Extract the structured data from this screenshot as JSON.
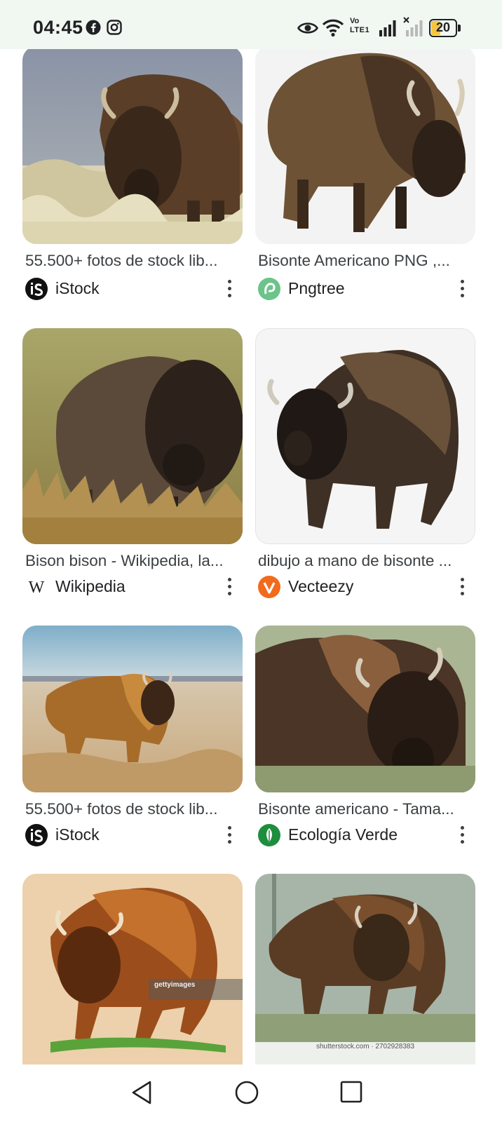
{
  "status_bar": {
    "time": "04:45",
    "network_label_top": "Vo",
    "network_label_bottom": "LTE1",
    "battery": "20",
    "icons": [
      "facebook-icon",
      "instagram-icon",
      "eye-icon",
      "wifi-icon",
      "signal-icon",
      "no-signal-icon",
      "battery-icon"
    ]
  },
  "results": [
    {
      "caption": "55.500+ fotos de stock lib...",
      "source": "iStock",
      "logo_letter": "iS",
      "logo_color": "#111111"
    },
    {
      "caption": "Bisonte Americano PNG ,...",
      "source": "Pngtree",
      "logo_letter": "p",
      "logo_color": "#5fbf7f"
    },
    {
      "caption": "Bison bison - Wikipedia, la...",
      "source": "Wikipedia",
      "logo_letter": "W",
      "logo_color": "#ffffff"
    },
    {
      "caption": "dibujo a mano de bisonte ...",
      "source": "Vecteezy",
      "logo_letter": "V",
      "logo_color": "#f26a1b"
    },
    {
      "caption": "55.500+ fotos de stock lib...",
      "source": "iStock",
      "logo_letter": "iS",
      "logo_color": "#111111"
    },
    {
      "caption": "Bisonte americano - Tama...",
      "source": "Ecología Verde",
      "logo_letter": "e",
      "logo_color": "#1e8e3e"
    },
    {
      "caption": "",
      "source": "",
      "watermark": "gettyimages"
    },
    {
      "caption": "",
      "source": "",
      "watermark": "shutterstock.com · 2702928383"
    }
  ],
  "nav_bar": {
    "icons": [
      "back-icon",
      "home-icon",
      "recents-icon"
    ]
  }
}
